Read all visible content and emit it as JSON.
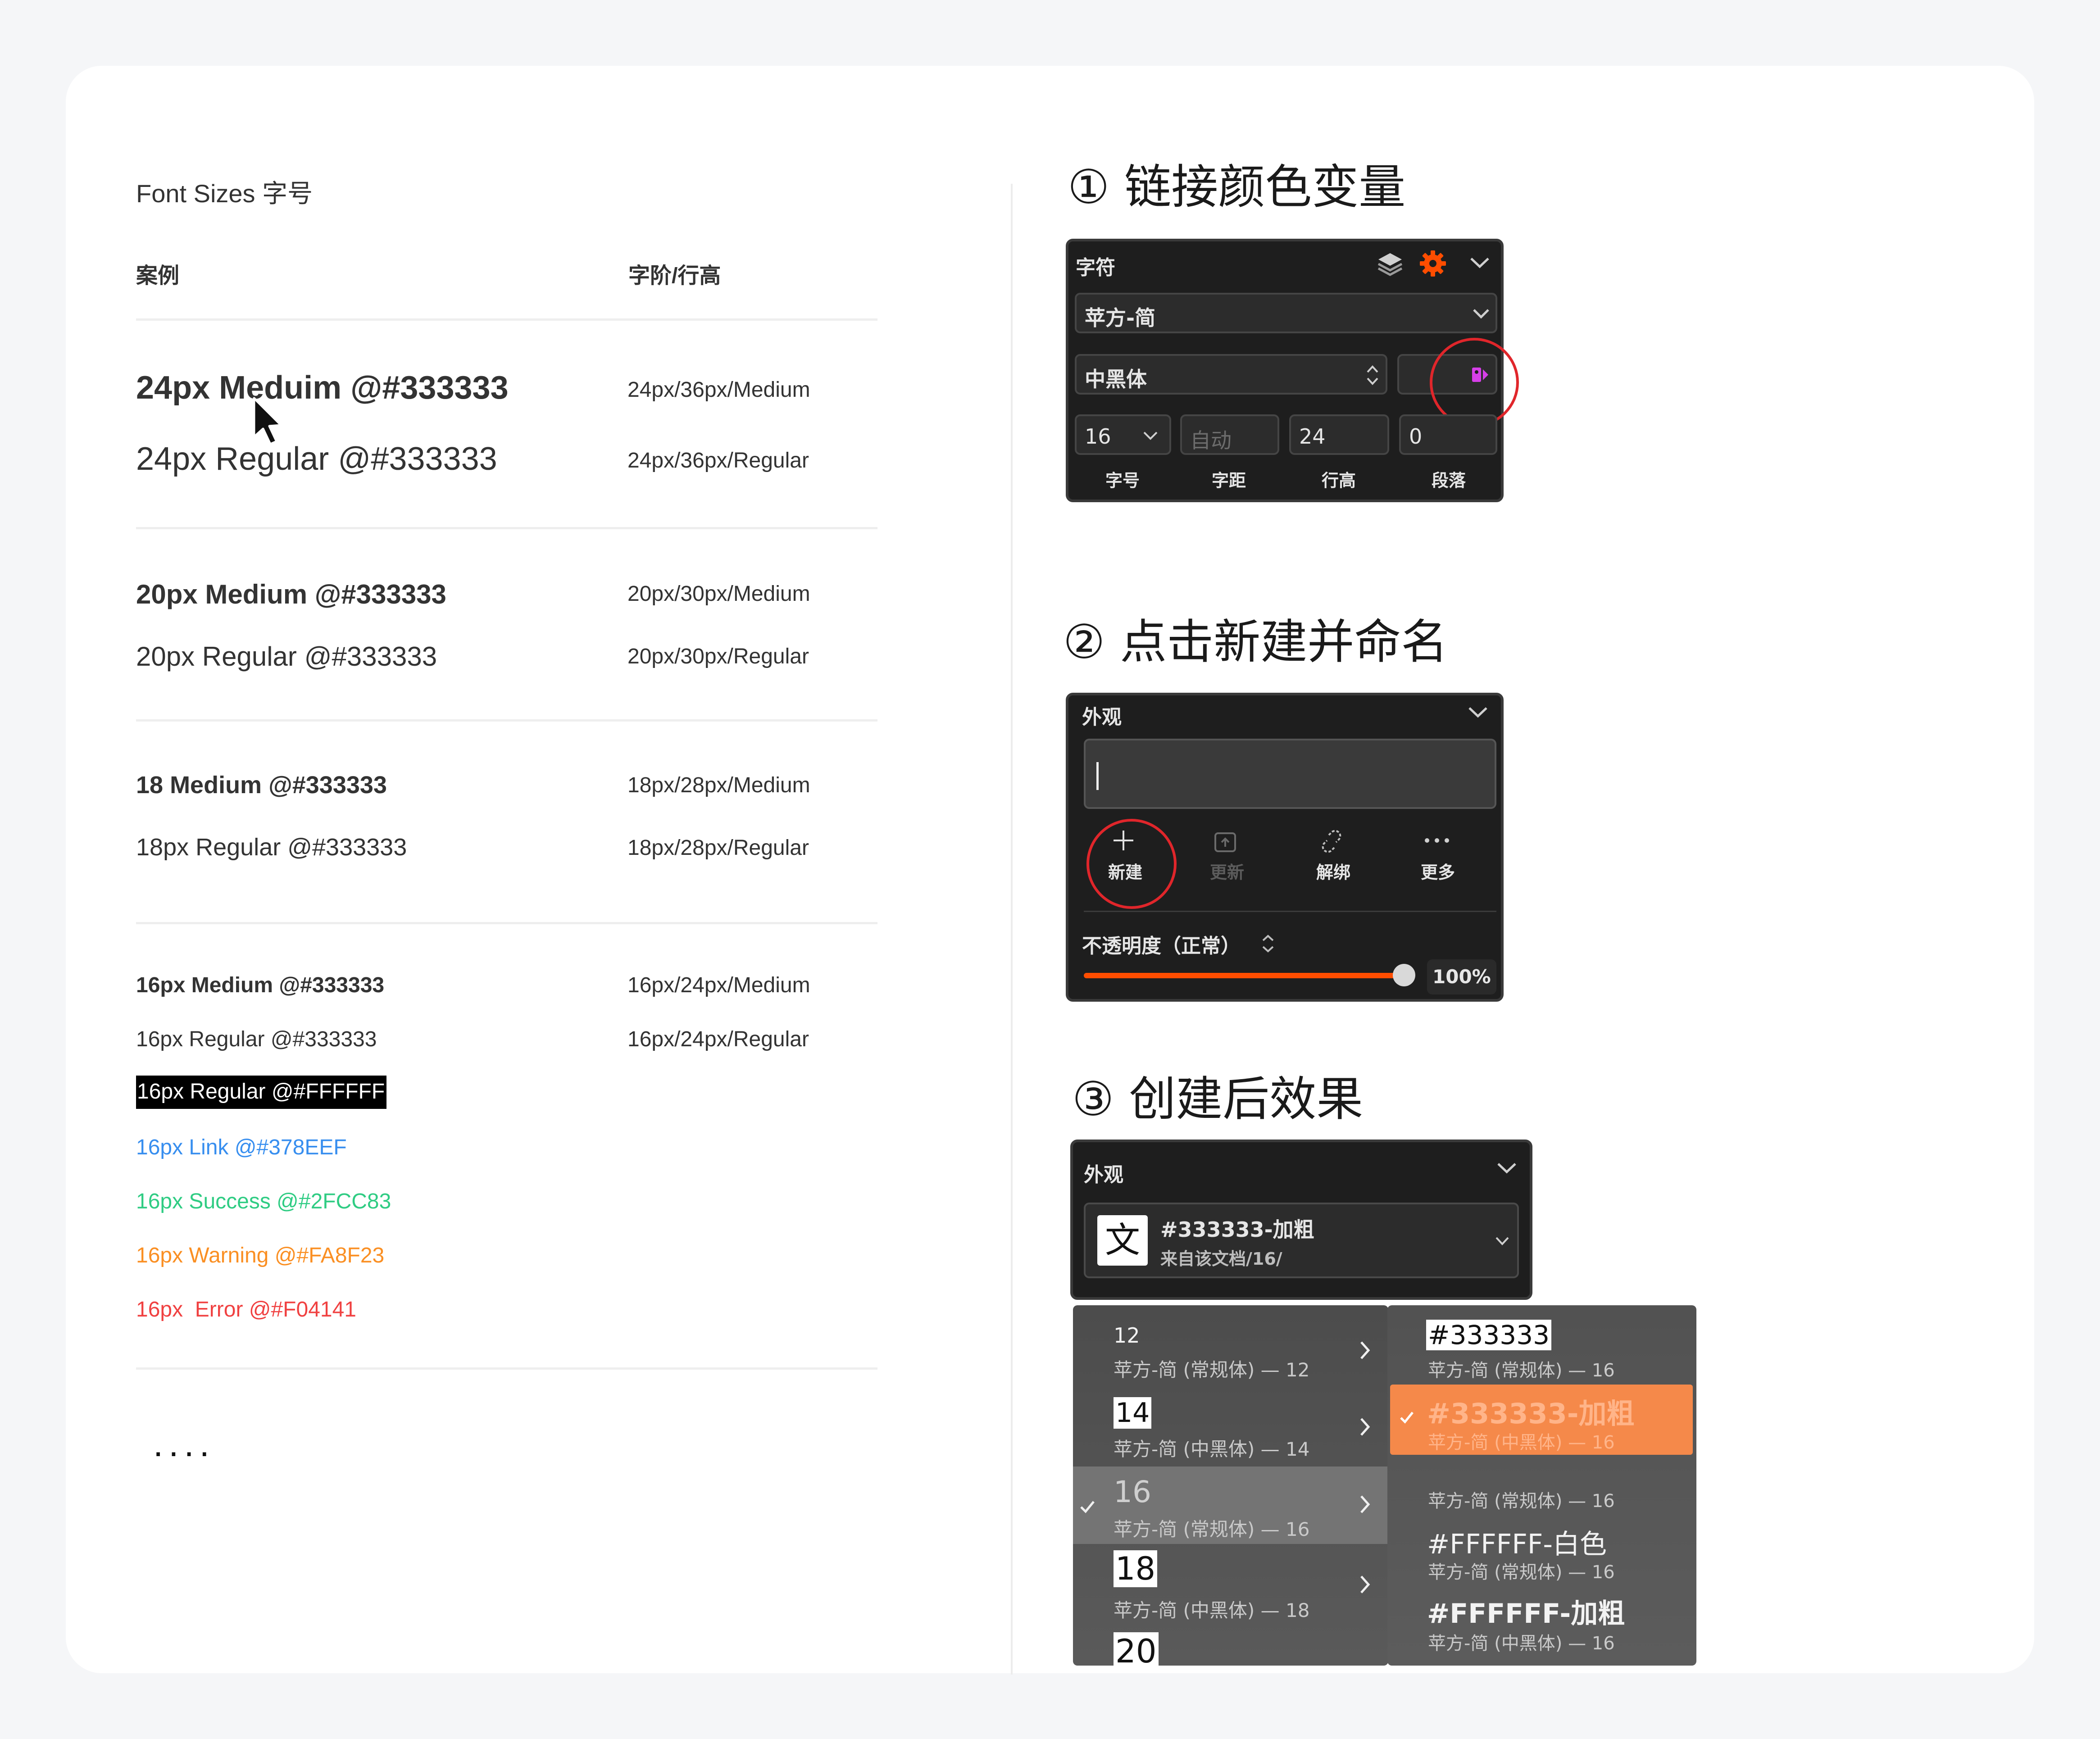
{
  "left": {
    "section_title": "Font Sizes 字号",
    "col_example": "案例",
    "col_spec": "字阶/行高",
    "rows": [
      {
        "example": "24px Meduim @#333333",
        "spec": "24px/36px/Medium"
      },
      {
        "example": "24px Regular @#333333",
        "spec": "24px/36px/Regular"
      },
      {
        "example": "20px Medium @#333333",
        "spec": "20px/30px/Medium"
      },
      {
        "example": "20px Regular @#333333",
        "spec": "20px/30px/Regular"
      },
      {
        "example": "18 Medium @#333333",
        "spec": "18px/28px/Medium"
      },
      {
        "example": "18px Regular @#333333",
        "spec": "18px/28px/Regular"
      },
      {
        "example": "16px Medium @#333333",
        "spec": "16px/24px/Medium"
      },
      {
        "example": "16px Regular @#333333",
        "spec": "16px/24px/Regular"
      }
    ],
    "colored": [
      {
        "text": "16px Regular @#FFFFFF",
        "color": "#FFFFFF"
      },
      {
        "text": "16px Link @#378EEF",
        "color": "#378EEF"
      },
      {
        "text": "16px Success @#2FCC83",
        "color": "#2FCC83"
      },
      {
        "text": "16px Warning @#FA8F23",
        "color": "#FA8F23"
      },
      {
        "text": "16px  Error @#F04141",
        "color": "#F04141"
      }
    ],
    "ellipsis": "....",
    "cursor_icon": "mouse-pointer-icon"
  },
  "steps": {
    "step1": "① 链接颜色变量",
    "step2": "② 点击新建并命名",
    "step3": "③ 创建后效果"
  },
  "panel1": {
    "title": "字符",
    "font_family": "苹方-简",
    "font_weight": "中黑体",
    "size": "16",
    "letter_spacing_placeholder": "自动",
    "line_height": "24",
    "paragraph": "0",
    "labels": [
      "字号",
      "字距",
      "行高",
      "段落"
    ],
    "accent": "#ff4d00",
    "link_icon_color": "#d63fe8"
  },
  "panel2": {
    "title": "外观",
    "actions": [
      "新建",
      "更新",
      "解绑",
      "更多"
    ],
    "opacity_label": "不透明度（正常）",
    "opacity_value": "100%",
    "opacity": 1.0,
    "slider_color": "#ff4d00"
  },
  "panel3": {
    "title": "外观",
    "style_name": "#333333-加粗",
    "style_source": "来自该文档/16/",
    "style_icon": "文"
  },
  "menu_left": [
    {
      "size": "12",
      "desc": "苹方-简 (常规体) — 12",
      "checked": false,
      "highlight": false
    },
    {
      "size": "14",
      "desc": "苹方-简 (中黑体) — 14",
      "checked": false,
      "highlight": true
    },
    {
      "size": "16",
      "desc": "苹方-简 (常规体) — 16",
      "checked": true,
      "highlight": false
    },
    {
      "size": "18",
      "desc": "苹方-简 (中黑体) — 18",
      "checked": false,
      "highlight": true
    },
    {
      "size": "20",
      "desc": "",
      "checked": false,
      "highlight": true
    }
  ],
  "menu_right": [
    {
      "name": "#333333",
      "desc": "苹方-简 (常规体) — 16"
    },
    {
      "name": "#333333-加粗",
      "desc": "苹方-简 (中黑体) — 16",
      "selected": true
    },
    {
      "name": "",
      "desc": "苹方-简 (常规体) — 16"
    },
    {
      "name": "#FFFFFF-白色",
      "desc": "苹方-简 (常规体) — 16"
    },
    {
      "name": "#FFFFFF-加粗",
      "desc": "苹方-简 (中黑体) — 16"
    }
  ],
  "menu_selected_color": "#f5894a"
}
